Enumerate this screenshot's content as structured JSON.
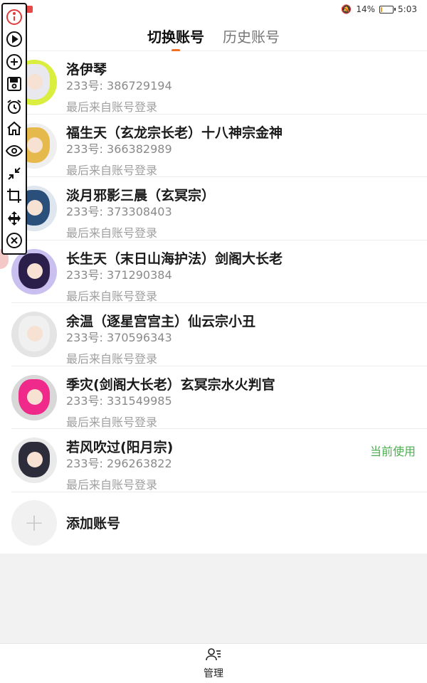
{
  "status_bar": {
    "battery": "14%",
    "time": "5:03",
    "battery_level": 0.14
  },
  "tabs": [
    {
      "label": "切换账号",
      "active": true
    },
    {
      "label": "历史账号",
      "active": false
    }
  ],
  "accounts": [
    {
      "name": "洛伊琴",
      "uid": "233号: 386729194",
      "last": "最后来自账号登录",
      "bg": "#d9ee3e",
      "hair": "#e8e8ee"
    },
    {
      "name": "福生天（玄龙宗长老）十八神宗金神",
      "uid": "233号: 366382989",
      "last": "最后来自账号登录",
      "bg": "#efefef",
      "hair": "#e6b94c"
    },
    {
      "name": "淡月邪影三晨（玄冥宗）",
      "uid": "233号: 373308403",
      "last": "最后来自账号登录",
      "bg": "#dfe6ee",
      "hair": "#2a4f7a"
    },
    {
      "name": "长生天（末日山海护法）剑阁大长老",
      "uid": "233号: 371290384",
      "last": "最后来自账号登录",
      "bg": "#c9c0f0",
      "hair": "#2a1e4a"
    },
    {
      "name": "余温（逐星宫宫主）仙云宗小丑",
      "uid": "233号: 370596343",
      "last": "最后来自账号登录",
      "bg": "#e4e4e4",
      "hair": "#f0f0f0"
    },
    {
      "name": "季灾(剑阁大长老）玄冥宗水火判官",
      "uid": "233号: 331549985",
      "last": "最后来自账号登录",
      "bg": "#d8d8d8",
      "hair": "#f02a8a"
    },
    {
      "name": "若风吹过(阳月宗)",
      "uid": "233号: 296263822",
      "last": "最后来自账号登录",
      "bg": "#eaeaea",
      "hair": "#2c2c3a",
      "current": "当前使用"
    }
  ],
  "add_account": {
    "label": "添加账号",
    "icon": "plus-icon"
  },
  "bottom_nav": {
    "label": "管理",
    "icon": "user-manage-icon"
  },
  "colors": {
    "accent": "#f36f21",
    "current": "#4caf50",
    "toolbar_info": "#e23b3b"
  },
  "toolbar_icons": [
    "info-icon",
    "play-icon",
    "plus-circle-icon",
    "save-icon",
    "alarm-icon",
    "home-icon",
    "eye-icon",
    "shrink-icon",
    "crop-icon",
    "move-icon",
    "close-circle-icon"
  ]
}
